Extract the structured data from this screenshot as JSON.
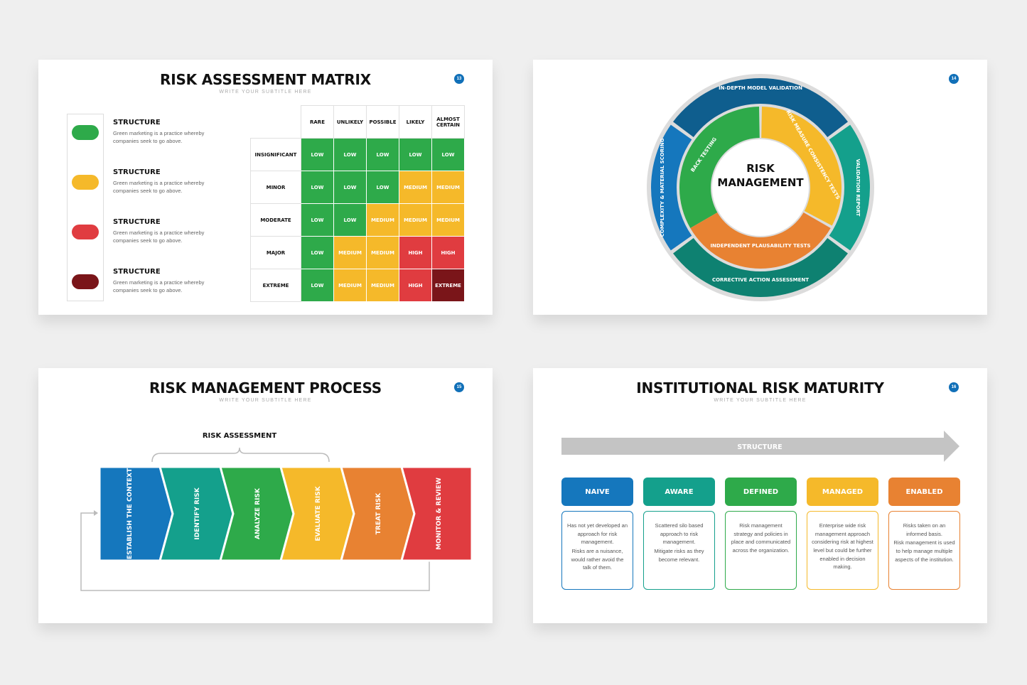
{
  "slides": [
    {
      "title": "RISK ASSESSMENT MATRIX",
      "subtitle": "WRITE YOUR SUBTITLE HERE",
      "page": "13",
      "legend": [
        {
          "heading": "STRUCTURE",
          "text": "Green marketing is a practice whereby companies seek to go above.",
          "color": "#2eaa4a"
        },
        {
          "heading": "STRUCTURE",
          "text": "Green marketing is a practice whereby companies seek to go above.",
          "color": "#f5b92a"
        },
        {
          "heading": "STRUCTURE",
          "text": "Green marketing is a practice whereby companies seek to go above.",
          "color": "#e03c40"
        },
        {
          "heading": "STRUCTURE",
          "text": "Green marketing is a practice whereby companies seek to go above.",
          "color": "#7a1519"
        }
      ],
      "matrix": {
        "columns": [
          "RARE",
          "UNLIKELY",
          "POSSIBLE",
          "LIKELY",
          "ALMOST CERTAIN"
        ],
        "rows": [
          {
            "label": "INSIGNIFICANT",
            "cells": [
              "LOW",
              "LOW",
              "LOW",
              "LOW",
              "LOW"
            ]
          },
          {
            "label": "MINOR",
            "cells": [
              "LOW",
              "LOW",
              "LOW",
              "MEDIUM",
              "MEDIUM"
            ]
          },
          {
            "label": "MODERATE",
            "cells": [
              "LOW",
              "LOW",
              "MEDIUM",
              "MEDIUM",
              "MEDIUM"
            ]
          },
          {
            "label": "MAJOR",
            "cells": [
              "LOW",
              "MEDIUM",
              "MEDIUM",
              "HIGH",
              "HIGH"
            ]
          },
          {
            "label": "EXTREME",
            "cells": [
              "LOW",
              "MEDIUM",
              "MEDIUM",
              "HIGH",
              "EXTREME"
            ]
          }
        ],
        "level_colors": {
          "LOW": "#2eaa4a",
          "MEDIUM": "#f5b92a",
          "HIGH": "#e03c40",
          "EXTREME": "#7a1519"
        }
      }
    },
    {
      "page": "14",
      "center": [
        "RISK",
        "MANAGEMENT"
      ],
      "inner": [
        {
          "label": "BACK TESTING",
          "color": "#2eaa4a"
        },
        {
          "label": "RISK MEASURE CONSISTENCY TESTS",
          "color": "#f5b92a"
        },
        {
          "label": "INDEPENDENT PLAUSABILITY TESTS",
          "color": "#e88232"
        }
      ],
      "outer": [
        {
          "label": "IN-DEPTH MODEL VALIDATION",
          "color": "#0f5e8e"
        },
        {
          "label": "VALIDATION REPORT",
          "color": "#14a08c"
        },
        {
          "label": "CORRECTIVE ACTION ASSESSMENT",
          "color": "#0e8171"
        },
        {
          "label": "COMPLEXITY & MATERIAL SCORING",
          "color": "#1577bd"
        }
      ]
    },
    {
      "title": "RISK MANAGEMENT PROCESS",
      "subtitle": "WRITE YOUR SUBTITLE HERE",
      "page": "15",
      "bracket_label": "RISK ASSESSMENT",
      "steps": [
        {
          "label": "ESTABLISH THE CONTEXT",
          "color": "#1577bd"
        },
        {
          "label": "IDENTIFY RISK",
          "color": "#14a08c"
        },
        {
          "label": "ANALYZE RISK",
          "color": "#2eaa4a"
        },
        {
          "label": "EVALUATE RISK",
          "color": "#f5b92a"
        },
        {
          "label": "TREAT RISK",
          "color": "#e88232"
        },
        {
          "label": "MONITOR & REVIEW",
          "color": "#e03c40"
        }
      ]
    },
    {
      "title": "INSTITUTIONAL RISK MATURITY",
      "subtitle": "WRITE YOUR SUBTITLE HERE",
      "page": "16",
      "arrow_label": "STRUCTURE",
      "stages": [
        {
          "label": "NAIVE",
          "color": "#1577bd",
          "text": [
            "Has not yet developed an approach for risk management.",
            "Risks are a nuisance, would rather avoid the talk of them."
          ]
        },
        {
          "label": "AWARE",
          "color": "#14a08c",
          "text": [
            "Scattered silo based approach to risk management.",
            "Mitigate risks as they become relevant."
          ]
        },
        {
          "label": "DEFINED",
          "color": "#2eaa4a",
          "text": [
            "Risk management strategy and policies in place and communicated across the organization."
          ]
        },
        {
          "label": "MANAGED",
          "color": "#f5b92a",
          "text": [
            "Enterprise wide risk management approach considering risk at highest level but could be further enabled in decision making."
          ]
        },
        {
          "label": "ENABLED",
          "color": "#e88232",
          "text": [
            "Risks taken on an informed basis.",
            "Risk management is used to help manage multiple aspects of the institution."
          ]
        }
      ]
    }
  ]
}
